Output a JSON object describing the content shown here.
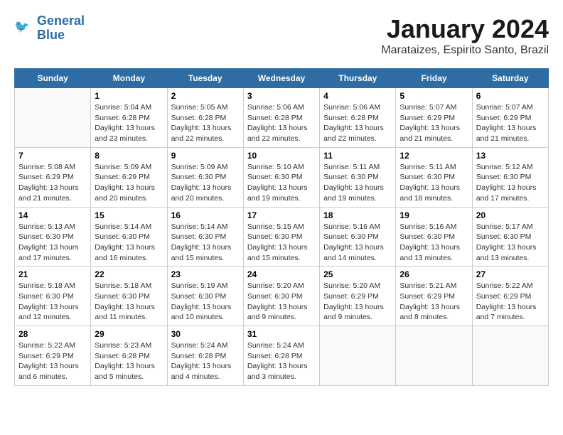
{
  "header": {
    "logo_line1": "General",
    "logo_line2": "Blue",
    "title": "January 2024",
    "subtitle": "Marataizes, Espirito Santo, Brazil"
  },
  "days_of_week": [
    "Sunday",
    "Monday",
    "Tuesday",
    "Wednesday",
    "Thursday",
    "Friday",
    "Saturday"
  ],
  "weeks": [
    [
      {
        "day": "",
        "sunrise": "",
        "sunset": "",
        "daylight": ""
      },
      {
        "day": "1",
        "sunrise": "Sunrise: 5:04 AM",
        "sunset": "Sunset: 6:28 PM",
        "daylight": "Daylight: 13 hours and 23 minutes."
      },
      {
        "day": "2",
        "sunrise": "Sunrise: 5:05 AM",
        "sunset": "Sunset: 6:28 PM",
        "daylight": "Daylight: 13 hours and 22 minutes."
      },
      {
        "day": "3",
        "sunrise": "Sunrise: 5:06 AM",
        "sunset": "Sunset: 6:28 PM",
        "daylight": "Daylight: 13 hours and 22 minutes."
      },
      {
        "day": "4",
        "sunrise": "Sunrise: 5:06 AM",
        "sunset": "Sunset: 6:28 PM",
        "daylight": "Daylight: 13 hours and 22 minutes."
      },
      {
        "day": "5",
        "sunrise": "Sunrise: 5:07 AM",
        "sunset": "Sunset: 6:29 PM",
        "daylight": "Daylight: 13 hours and 21 minutes."
      },
      {
        "day": "6",
        "sunrise": "Sunrise: 5:07 AM",
        "sunset": "Sunset: 6:29 PM",
        "daylight": "Daylight: 13 hours and 21 minutes."
      }
    ],
    [
      {
        "day": "7",
        "sunrise": "Sunrise: 5:08 AM",
        "sunset": "Sunset: 6:29 PM",
        "daylight": "Daylight: 13 hours and 21 minutes."
      },
      {
        "day": "8",
        "sunrise": "Sunrise: 5:09 AM",
        "sunset": "Sunset: 6:29 PM",
        "daylight": "Daylight: 13 hours and 20 minutes."
      },
      {
        "day": "9",
        "sunrise": "Sunrise: 5:09 AM",
        "sunset": "Sunset: 6:30 PM",
        "daylight": "Daylight: 13 hours and 20 minutes."
      },
      {
        "day": "10",
        "sunrise": "Sunrise: 5:10 AM",
        "sunset": "Sunset: 6:30 PM",
        "daylight": "Daylight: 13 hours and 19 minutes."
      },
      {
        "day": "11",
        "sunrise": "Sunrise: 5:11 AM",
        "sunset": "Sunset: 6:30 PM",
        "daylight": "Daylight: 13 hours and 19 minutes."
      },
      {
        "day": "12",
        "sunrise": "Sunrise: 5:11 AM",
        "sunset": "Sunset: 6:30 PM",
        "daylight": "Daylight: 13 hours and 18 minutes."
      },
      {
        "day": "13",
        "sunrise": "Sunrise: 5:12 AM",
        "sunset": "Sunset: 6:30 PM",
        "daylight": "Daylight: 13 hours and 17 minutes."
      }
    ],
    [
      {
        "day": "14",
        "sunrise": "Sunrise: 5:13 AM",
        "sunset": "Sunset: 6:30 PM",
        "daylight": "Daylight: 13 hours and 17 minutes."
      },
      {
        "day": "15",
        "sunrise": "Sunrise: 5:14 AM",
        "sunset": "Sunset: 6:30 PM",
        "daylight": "Daylight: 13 hours and 16 minutes."
      },
      {
        "day": "16",
        "sunrise": "Sunrise: 5:14 AM",
        "sunset": "Sunset: 6:30 PM",
        "daylight": "Daylight: 13 hours and 15 minutes."
      },
      {
        "day": "17",
        "sunrise": "Sunrise: 5:15 AM",
        "sunset": "Sunset: 6:30 PM",
        "daylight": "Daylight: 13 hours and 15 minutes."
      },
      {
        "day": "18",
        "sunrise": "Sunrise: 5:16 AM",
        "sunset": "Sunset: 6:30 PM",
        "daylight": "Daylight: 13 hours and 14 minutes."
      },
      {
        "day": "19",
        "sunrise": "Sunrise: 5:16 AM",
        "sunset": "Sunset: 6:30 PM",
        "daylight": "Daylight: 13 hours and 13 minutes."
      },
      {
        "day": "20",
        "sunrise": "Sunrise: 5:17 AM",
        "sunset": "Sunset: 6:30 PM",
        "daylight": "Daylight: 13 hours and 13 minutes."
      }
    ],
    [
      {
        "day": "21",
        "sunrise": "Sunrise: 5:18 AM",
        "sunset": "Sunset: 6:30 PM",
        "daylight": "Daylight: 13 hours and 12 minutes."
      },
      {
        "day": "22",
        "sunrise": "Sunrise: 5:18 AM",
        "sunset": "Sunset: 6:30 PM",
        "daylight": "Daylight: 13 hours and 11 minutes."
      },
      {
        "day": "23",
        "sunrise": "Sunrise: 5:19 AM",
        "sunset": "Sunset: 6:30 PM",
        "daylight": "Daylight: 13 hours and 10 minutes."
      },
      {
        "day": "24",
        "sunrise": "Sunrise: 5:20 AM",
        "sunset": "Sunset: 6:30 PM",
        "daylight": "Daylight: 13 hours and 9 minutes."
      },
      {
        "day": "25",
        "sunrise": "Sunrise: 5:20 AM",
        "sunset": "Sunset: 6:29 PM",
        "daylight": "Daylight: 13 hours and 9 minutes."
      },
      {
        "day": "26",
        "sunrise": "Sunrise: 5:21 AM",
        "sunset": "Sunset: 6:29 PM",
        "daylight": "Daylight: 13 hours and 8 minutes."
      },
      {
        "day": "27",
        "sunrise": "Sunrise: 5:22 AM",
        "sunset": "Sunset: 6:29 PM",
        "daylight": "Daylight: 13 hours and 7 minutes."
      }
    ],
    [
      {
        "day": "28",
        "sunrise": "Sunrise: 5:22 AM",
        "sunset": "Sunset: 6:29 PM",
        "daylight": "Daylight: 13 hours and 6 minutes."
      },
      {
        "day": "29",
        "sunrise": "Sunrise: 5:23 AM",
        "sunset": "Sunset: 6:28 PM",
        "daylight": "Daylight: 13 hours and 5 minutes."
      },
      {
        "day": "30",
        "sunrise": "Sunrise: 5:24 AM",
        "sunset": "Sunset: 6:28 PM",
        "daylight": "Daylight: 13 hours and 4 minutes."
      },
      {
        "day": "31",
        "sunrise": "Sunrise: 5:24 AM",
        "sunset": "Sunset: 6:28 PM",
        "daylight": "Daylight: 13 hours and 3 minutes."
      },
      {
        "day": "",
        "sunrise": "",
        "sunset": "",
        "daylight": ""
      },
      {
        "day": "",
        "sunrise": "",
        "sunset": "",
        "daylight": ""
      },
      {
        "day": "",
        "sunrise": "",
        "sunset": "",
        "daylight": ""
      }
    ]
  ]
}
